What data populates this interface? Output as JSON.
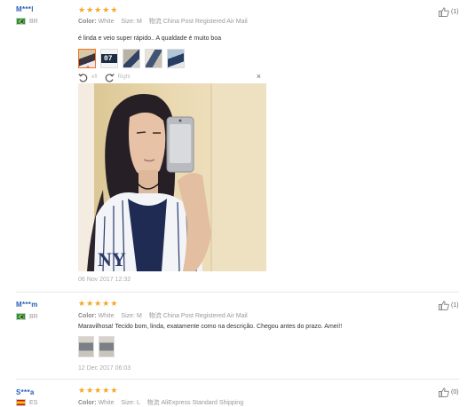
{
  "reviews": [
    {
      "user": "M***l",
      "country": "BR",
      "stars": 5,
      "color_label": "Color:",
      "color_value": "White",
      "size_label": "Size:",
      "size_value": "M",
      "shipping_label": "物流",
      "shipping_value": "China Post Registered Air Mail",
      "helpful_count": "(1)",
      "text": "é linda e veio super rápido.. A qualdade é muito boa",
      "photo_numbers": [
        "",
        "07",
        "",
        "",
        ""
      ],
      "viewer": {
        "left_label": "eft",
        "right_label": "Right",
        "close": "×"
      },
      "date": "06 Nov 2017 12:32"
    },
    {
      "user": "M***m",
      "country": "BR",
      "stars": 5,
      "color_label": "Color:",
      "color_value": "White",
      "size_label": "Size:",
      "size_value": "M",
      "shipping_label": "物流",
      "shipping_value": "China Post Registered Air Mail",
      "helpful_count": "(1)",
      "text": "Maravilhosa! Tecido bom, linda, exatamente como na descrição. Chegou antes do prazo. Amei!!",
      "date": "12 Dec 2017 06:03"
    },
    {
      "user": "S***a",
      "country": "ES",
      "stars": 5,
      "color_label": "Color:",
      "color_value": "White",
      "size_label": "Size:",
      "size_value": "L",
      "shipping_label": "物流",
      "shipping_value": "AliExpress Standard Shipping",
      "helpful_count": "(0)"
    }
  ],
  "colors": {
    "star": "#f5a623",
    "name": "#2a60b8",
    "active_border": "#f57224"
  },
  "icons": {
    "thumb": "thumbs-up-icon",
    "rotate_left": "rotate-left-icon",
    "rotate_right": "rotate-right-icon",
    "close": "close-icon"
  }
}
